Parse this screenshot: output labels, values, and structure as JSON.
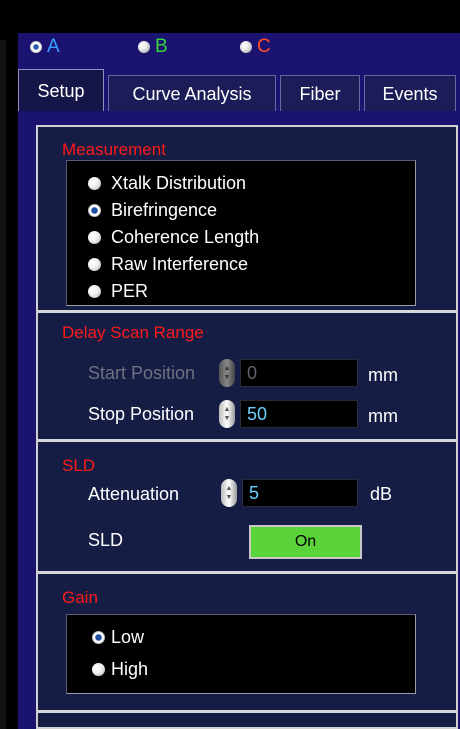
{
  "channels": [
    {
      "label": "A",
      "selected": true,
      "color": "#3aa0ff"
    },
    {
      "label": "B",
      "selected": false,
      "color": "#39d43a"
    },
    {
      "label": "C",
      "selected": false,
      "color": "#ff4d2a"
    }
  ],
  "tabs": [
    "Setup",
    "Curve Analysis",
    "Fiber",
    "Events"
  ],
  "active_tab": "Setup",
  "measurement": {
    "title": "Measurement",
    "options": [
      "Xtalk Distribution",
      "Birefringence",
      "Coherence Length",
      "Raw Interference",
      "PER"
    ],
    "selected": "Birefringence"
  },
  "delay_scan": {
    "title": "Delay Scan Range",
    "start_label": "Start Position",
    "start_value": "0",
    "start_unit": "mm",
    "stop_label": "Stop Position",
    "stop_value": "50",
    "stop_unit": "mm"
  },
  "sld": {
    "title": "SLD",
    "attenuation_label": "Attenuation",
    "attenuation_value": "5",
    "attenuation_unit": "dB",
    "sld_label": "SLD",
    "toggle_label": "On",
    "toggle_color": "#5bd33a"
  },
  "gain": {
    "title": "Gain",
    "options": [
      "Low",
      "High"
    ],
    "selected": "Low"
  },
  "colors": {
    "section_title": "#ff1a1a",
    "panel_bg": "#1a1370",
    "field_text": "#6bd0ff"
  }
}
